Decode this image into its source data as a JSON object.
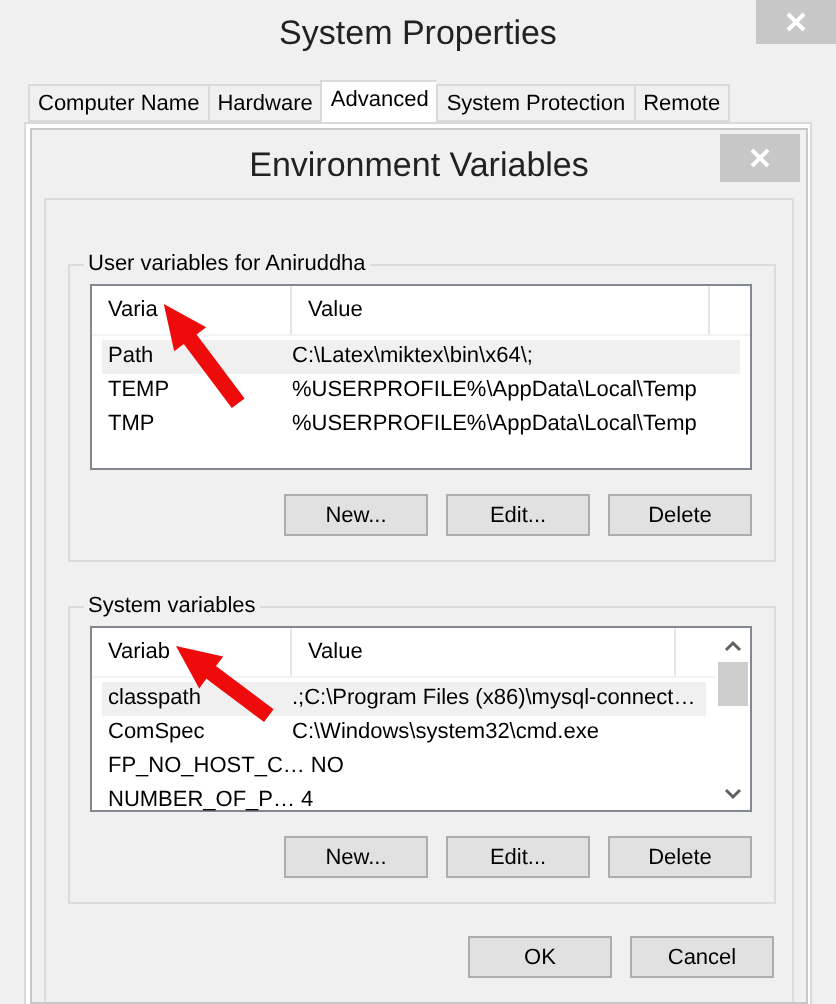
{
  "window": {
    "title": "System Properties"
  },
  "tabs": [
    {
      "label": "Computer Name",
      "selected": false
    },
    {
      "label": "Hardware",
      "selected": false
    },
    {
      "label": "Advanced",
      "selected": true
    },
    {
      "label": "System Protection",
      "selected": false
    },
    {
      "label": "Remote",
      "selected": false
    }
  ],
  "dialog": {
    "title": "Environment Variables",
    "groups": [
      {
        "title": "User variables for Aniruddha",
        "columns": [
          "Varia",
          "Value"
        ],
        "scrollable": false,
        "rows": [
          {
            "name": "Path",
            "value": "C:\\Latex\\miktex\\bin\\x64\\;",
            "selected": true
          },
          {
            "name": "TEMP",
            "value": "%USERPROFILE%\\AppData\\Local\\Temp",
            "selected": false
          },
          {
            "name": "TMP",
            "value": "%USERPROFILE%\\AppData\\Local\\Temp",
            "selected": false
          }
        ],
        "buttons": [
          "New...",
          "Edit...",
          "Delete"
        ]
      },
      {
        "title": "System variables",
        "columns": [
          "Variab",
          "Value"
        ],
        "scrollable": true,
        "rows": [
          {
            "name": "classpath",
            "value": ".;C:\\Program Files (x86)\\mysql-connect…",
            "selected": true
          },
          {
            "name": "ComSpec",
            "value": "C:\\Windows\\system32\\cmd.exe",
            "selected": false
          },
          {
            "name": "FP_NO_HOST_C…",
            "value": "NO",
            "selected": false
          },
          {
            "name": "NUMBER_OF_P…",
            "value": "4",
            "selected": false
          }
        ],
        "buttons": [
          "New...",
          "Edit...",
          "Delete"
        ]
      }
    ],
    "buttons": [
      "OK",
      "Cancel"
    ]
  }
}
